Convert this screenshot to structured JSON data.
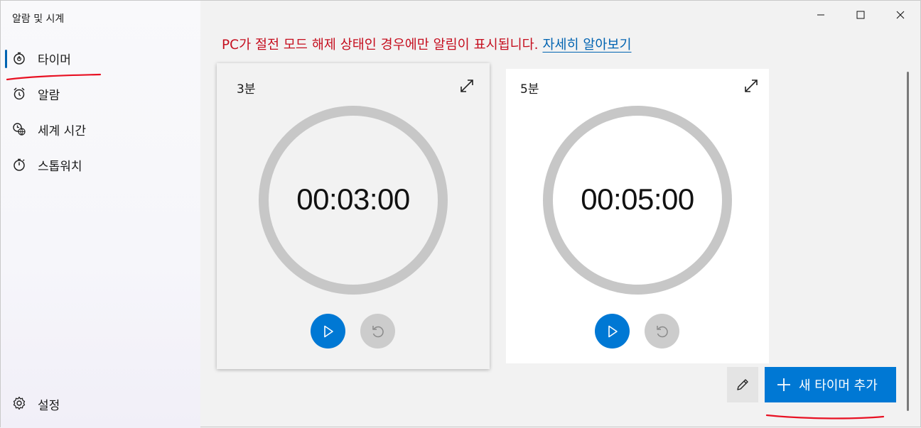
{
  "app": {
    "title": "알람 및 시계"
  },
  "sidebar": {
    "items": [
      {
        "label": "타이머",
        "icon": "timer-icon",
        "active": true
      },
      {
        "label": "알람",
        "icon": "alarm-clock-icon",
        "active": false
      },
      {
        "label": "세계 시간",
        "icon": "world-clock-icon",
        "active": false
      },
      {
        "label": "스톱워치",
        "icon": "stopwatch-icon",
        "active": false
      }
    ],
    "settings_label": "설정"
  },
  "notice": {
    "text": "PC가 절전 모드 해제 상태인 경우에만 알림이 표시됩니다.",
    "link": "자세히 알아보기"
  },
  "timers": [
    {
      "name": "3분",
      "time": "00:03:00"
    },
    {
      "name": "5분",
      "time": "00:05:00"
    }
  ],
  "actions": {
    "add_label": "새 타이머 추가"
  },
  "colors": {
    "accent": "#0078d4",
    "notice": "#c50f1f",
    "annotation": "#e81123"
  }
}
